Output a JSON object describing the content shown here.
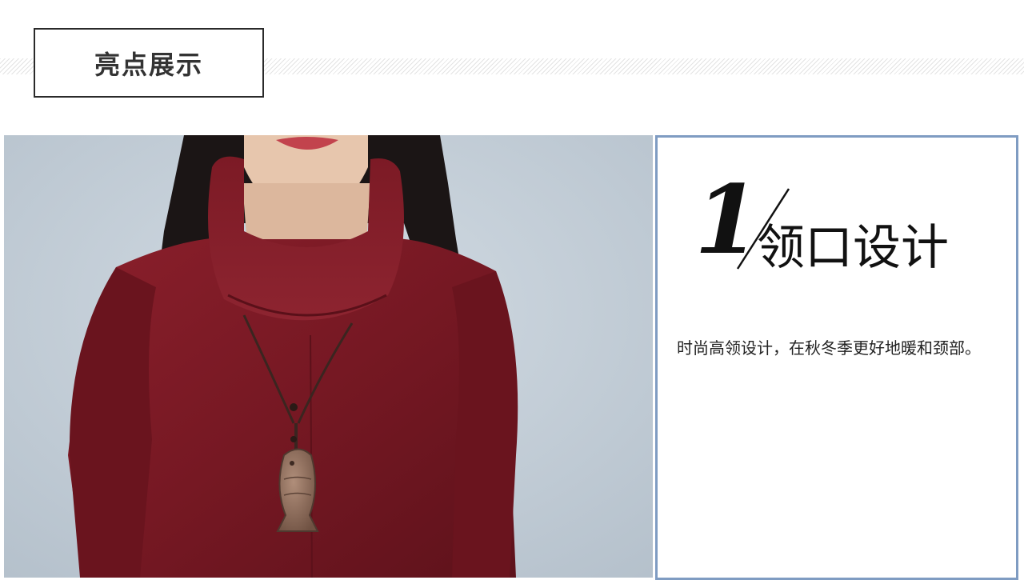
{
  "section": {
    "title": "亮点展示"
  },
  "feature": {
    "number": "1",
    "title": "领口设计",
    "description": "时尚高领设计，在秋冬季更好地暖和颈部。"
  },
  "photo": {
    "subject": "model-wearing-red-turtleneck-sweater-with-fish-pendant",
    "colors": {
      "background": "#c7d2db",
      "sweater": "#7a1a24",
      "hair": "#1a1414",
      "pendant": "#8a6a58"
    }
  },
  "colors": {
    "panel_border": "#7f9cc2",
    "title_border": "#2a2a2a",
    "text": "#111111"
  }
}
